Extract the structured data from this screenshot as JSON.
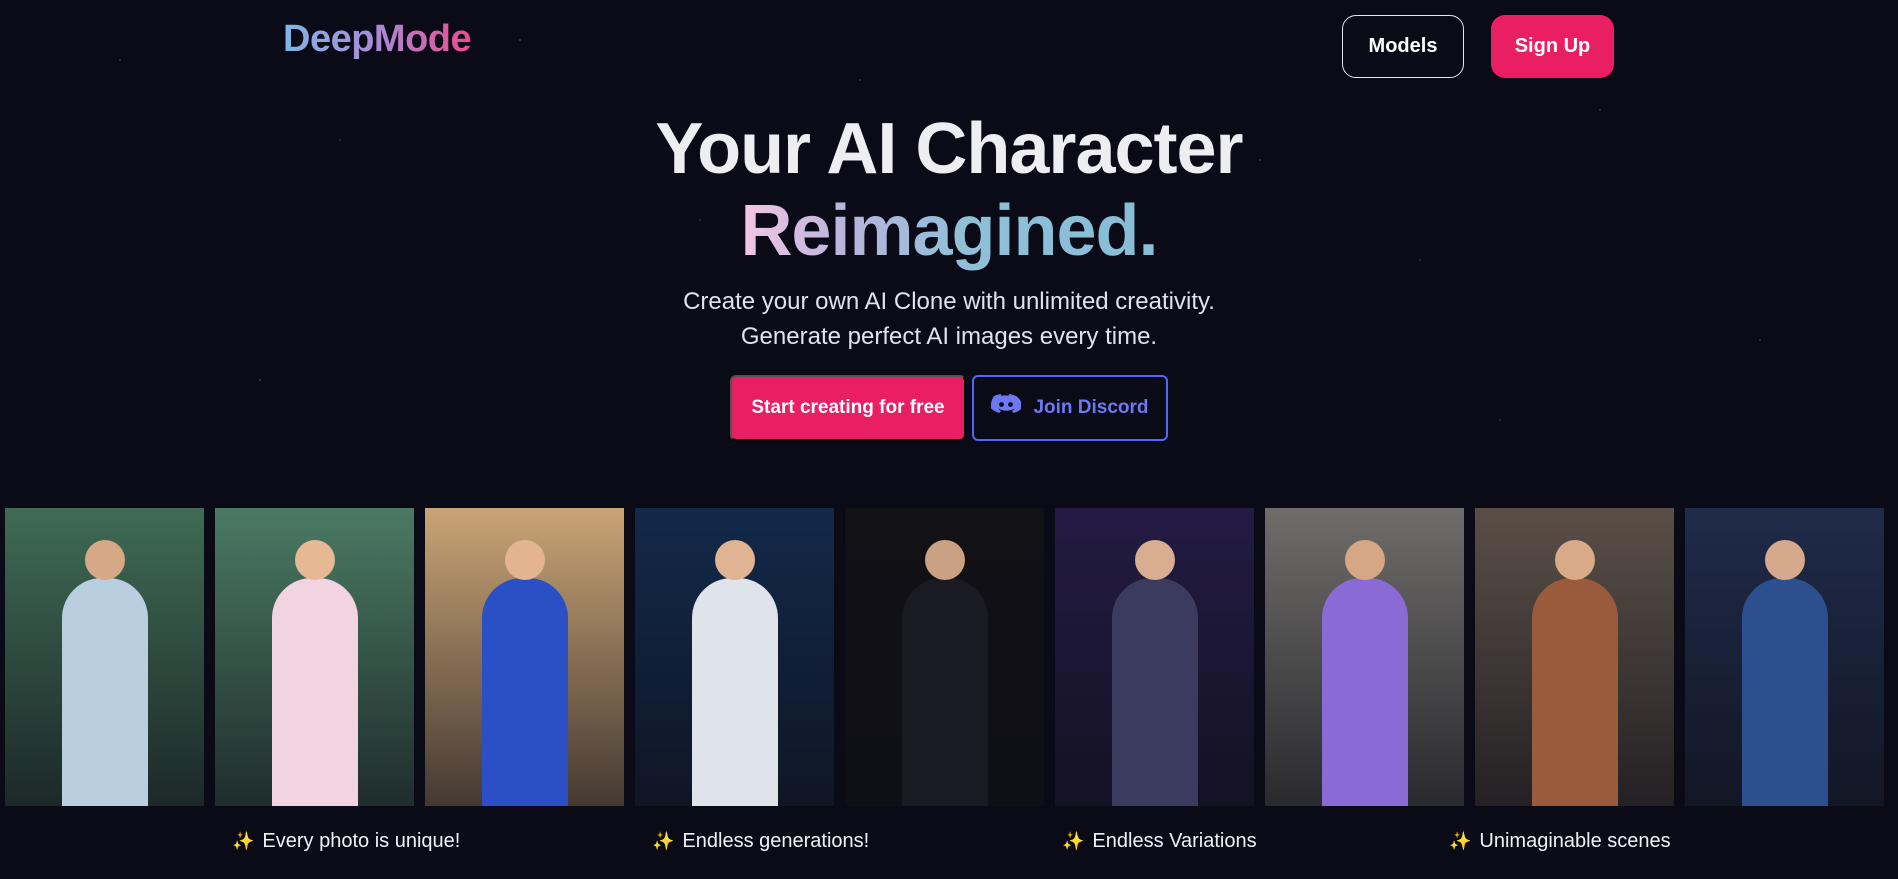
{
  "header": {
    "logo_text": "DeepMode",
    "models_label": "Models",
    "signup_label": "Sign Up"
  },
  "hero": {
    "title_line1": "Your AI Character",
    "title_line2": "Reimagined.",
    "subtitle_line1": "Create your own AI Clone with unlimited creativity.",
    "subtitle_line2": "Generate perfect AI images every time.",
    "primary_cta": "Start creating for free",
    "discord_cta": "Join Discord"
  },
  "gallery": {
    "photos": [
      {
        "name": "pool-portrait",
        "bg": "#3f6b55",
        "skin": "#d7a886",
        "outfit": "#b9cfe0"
      },
      {
        "name": "pool-selfie",
        "bg": "#4a7a63",
        "skin": "#e6b894",
        "outfit": "#f1d4e0"
      },
      {
        "name": "beach-pose",
        "bg": "#caa476",
        "skin": "#e2b590",
        "outfit": "#2b4fc4"
      },
      {
        "name": "gamer-room",
        "bg": "#12294a",
        "skin": "#e0b492",
        "outfit": "#dfe4ea"
      },
      {
        "name": "latex-suit",
        "bg": "#111116",
        "skin": "#caa283",
        "outfit": "#1a1a22"
      },
      {
        "name": "cyber-armor",
        "bg": "#231b44",
        "skin": "#d9ad8f",
        "outfit": "#3b3a5f"
      },
      {
        "name": "street-jacket",
        "bg": "#6f6d6a",
        "skin": "#d6a785",
        "outfit": "#8a6ad4"
      },
      {
        "name": "fashion-blazer",
        "bg": "#5a4f47",
        "skin": "#d9aa88",
        "outfit": "#9a5a3c"
      },
      {
        "name": "blue-dress",
        "bg": "#1f2b4a",
        "skin": "#d5a98b",
        "outfit": "#2d4f8f"
      }
    ]
  },
  "features": [
    {
      "label": "Every photo is unique!"
    },
    {
      "label": "Endless generations!"
    },
    {
      "label": "Endless Variations"
    },
    {
      "label": "Unimaginable scenes"
    }
  ],
  "colors": {
    "accent": "#e91e63",
    "discord": "#5865f2",
    "background": "#0b0b18"
  }
}
